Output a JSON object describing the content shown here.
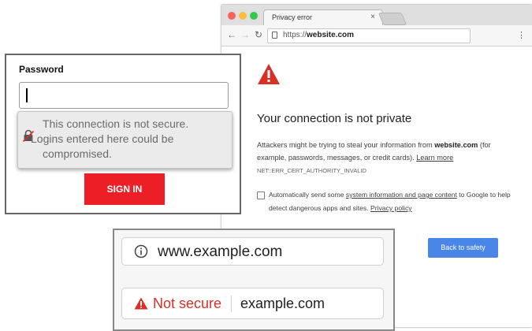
{
  "browser": {
    "tab_title": "Privacy error",
    "tab_close": "×",
    "url_scheme": "https://",
    "url_host": "website.com",
    "menu": "⋮",
    "error": {
      "title": "Your connection is not private",
      "desc_prefix": "Attackers might be trying to steal your information from ",
      "desc_host": "website.com",
      "desc_middle": " (for example, passwords, messages, or credit cards). ",
      "learn_more": "Learn more",
      "code": "NET::ERR_CERT_AUTHORITY_INVALID"
    },
    "report": {
      "prefix": "Automatically send some ",
      "link": "system information and page content",
      "middle": " to Google to help detect dangerous apps and sites. ",
      "privacy": "Privacy policy"
    },
    "back_to_safety": "Back to safety"
  },
  "password_panel": {
    "label": "Password",
    "tooltip_lines": [
      "This connection is not secure.",
      "Logins entered here could be",
      "compromised."
    ],
    "sign_in": "SIGN IN"
  },
  "url_bars": {
    "secure_host": "www.example.com",
    "not_secure_label": "Not secure",
    "insecure_host": "example.com"
  },
  "colors": {
    "warning_red": "#d93025",
    "signin_red": "#ec1f27",
    "safety_blue": "#4a86e8"
  }
}
